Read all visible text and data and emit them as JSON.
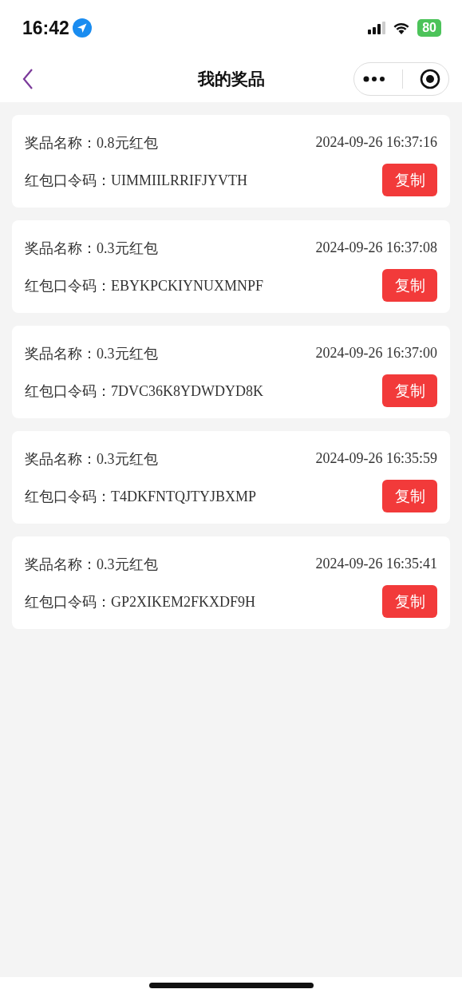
{
  "status_bar": {
    "time": "16:42",
    "battery": "80"
  },
  "nav": {
    "title": "我的奖品"
  },
  "prizes": [
    {
      "name": "奖品名称：0.8元红包",
      "time": "2024-09-26 16:37:16",
      "code": "红包口令码：UIMMIILRRIFJYVTH",
      "button": "复制"
    },
    {
      "name": "奖品名称：0.3元红包",
      "time": "2024-09-26 16:37:08",
      "code": "红包口令码：EBYKPCKIYNUXMNPF",
      "button": "复制"
    },
    {
      "name": "奖品名称：0.3元红包",
      "time": "2024-09-26 16:37:00",
      "code": "红包口令码：7DVC36K8YDWDYD8K",
      "button": "复制"
    },
    {
      "name": "奖品名称：0.3元红包",
      "time": "2024-09-26 16:35:59",
      "code": "红包口令码：T4DKFNTQJTYJBXMP",
      "button": "复制"
    },
    {
      "name": "奖品名称：0.3元红包",
      "time": "2024-09-26 16:35:41",
      "code": "红包口令码：GP2XIKEM2FKXDF9H",
      "button": "复制"
    }
  ]
}
